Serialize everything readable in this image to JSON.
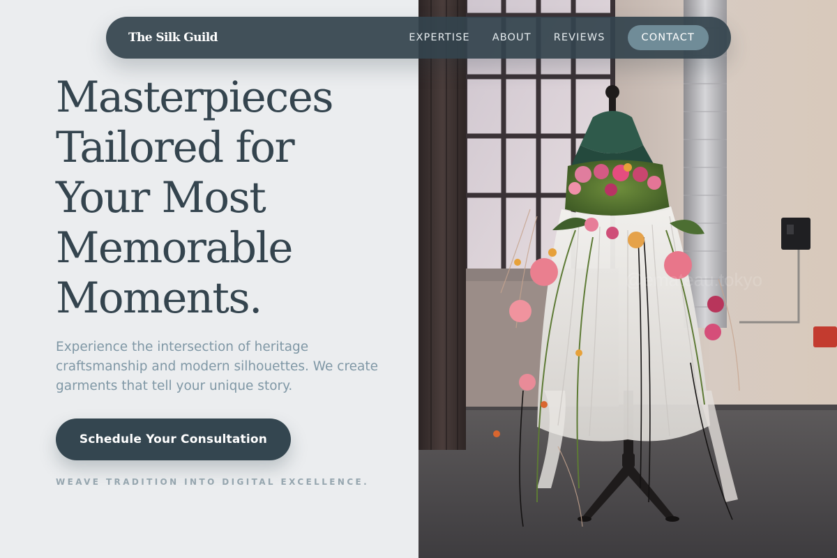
{
  "nav": {
    "brand": "The Silk Guild",
    "links": [
      {
        "label": "EXPERTISE"
      },
      {
        "label": "ABOUT"
      },
      {
        "label": "REVIEWS"
      }
    ],
    "contact_label": "CONTACT"
  },
  "hero": {
    "headline_lines": [
      "Masterpieces",
      "Tailored for",
      "Your Most",
      "Memorable",
      "Moments."
    ],
    "subtext": "Experience the intersection of heritage craftsmanship and modern silhouettes. We create garments that tell your unique story.",
    "cta_label": "Schedule Your Consultation",
    "tagline": "WEAVE TRADITION INTO DIGITAL EXCELLENCE."
  },
  "image": {
    "subject": "floral-dress-on-mannequin-photo"
  },
  "colors": {
    "primary": "#34444e",
    "accent": "#708c98",
    "muted_text": "#7f97a5",
    "background": "#ebedef"
  }
}
